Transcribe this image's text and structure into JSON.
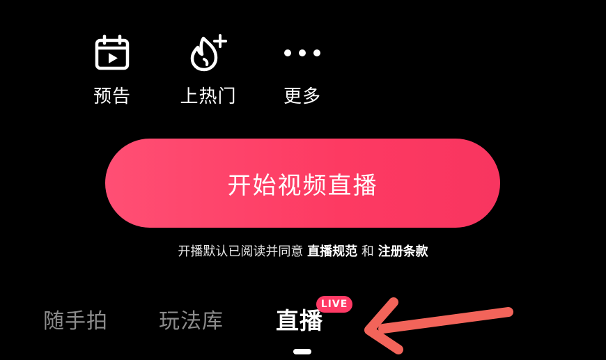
{
  "actions": {
    "preview": {
      "label": "预告",
      "icon": "calendar-play-icon"
    },
    "hot": {
      "label": "上热门",
      "icon": "flame-plus-icon"
    },
    "more": {
      "label": "更多",
      "icon": "more-dots-icon"
    }
  },
  "start_button": {
    "label": "开始视频直播"
  },
  "agreement": {
    "prefix": "开播默认已阅读并同意 ",
    "link1": "直播规范",
    "middle": " 和 ",
    "link2": "注册条款"
  },
  "tabs": [
    {
      "label": "随手拍"
    },
    {
      "label": "玩法库"
    },
    {
      "label": "直播",
      "badge": "LIVE",
      "active": true
    }
  ],
  "colors": {
    "accent": "#fd3a62",
    "annotation_arrow": "#f2645a",
    "inactive_tab": "#8c8c8c"
  }
}
